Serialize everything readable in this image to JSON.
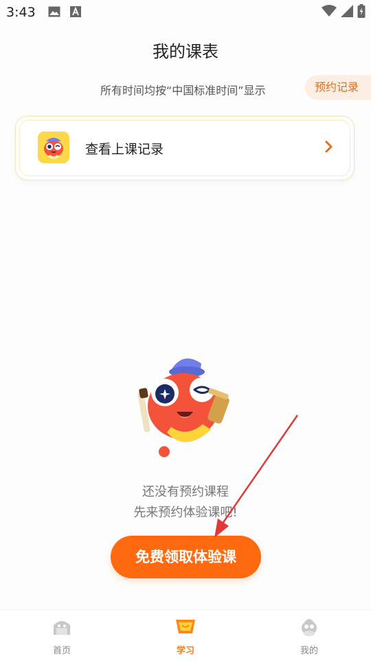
{
  "status_bar": {
    "time": "3:43",
    "icons": [
      "image-icon",
      "text-a-icon",
      "wifi-icon",
      "signal-icon",
      "battery-charging-icon"
    ]
  },
  "header": {
    "title": "我的课表",
    "timezone_note": "所有时间均按“中国标准时间”显示",
    "booking_record_label": "预约记录"
  },
  "class_record_card": {
    "label": "查看上课记录",
    "icon": "mascot-icon"
  },
  "empty_state": {
    "line1": "还没有预约课程",
    "line2": "先来预约体验课吧!",
    "button_label": "免费领取体验课"
  },
  "bottom_nav": {
    "items": [
      {
        "label": "首页",
        "icon": "home-icon",
        "active": false
      },
      {
        "label": "学习",
        "icon": "study-icon",
        "active": true
      },
      {
        "label": "我的",
        "icon": "profile-icon",
        "active": false
      }
    ]
  },
  "colors": {
    "accent": "#ff6a10",
    "accent_soft": "#fdeee3",
    "card_border": "#f6e4b4",
    "annotation_arrow": "#e0393a"
  }
}
